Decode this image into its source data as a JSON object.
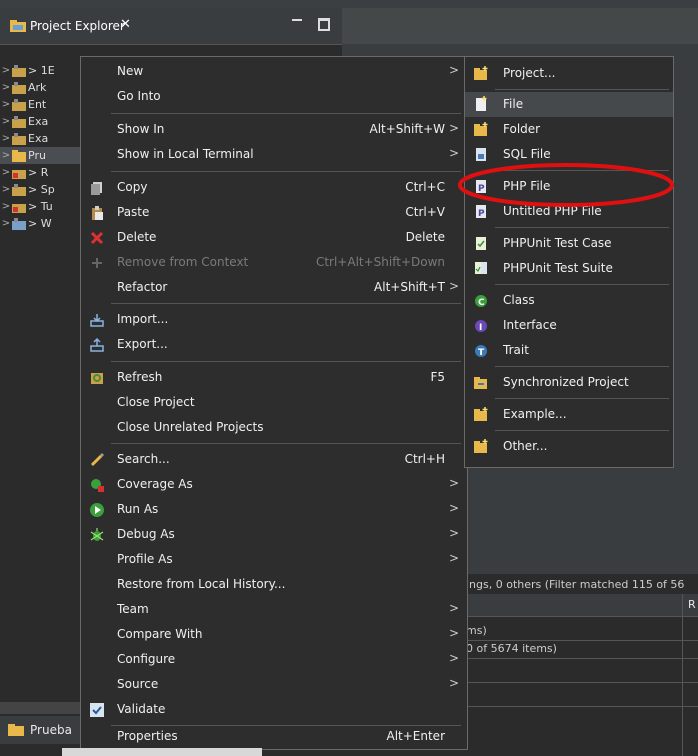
{
  "explorer": {
    "title": "Project Explorer",
    "tree": [
      {
        "label": "> 1E"
      },
      {
        "label": "Ark"
      },
      {
        "label": "Ent"
      },
      {
        "label": "Exa"
      },
      {
        "label": "Exa"
      },
      {
        "label": "Pru"
      },
      {
        "label": "> R"
      },
      {
        "label": "> Sp"
      },
      {
        "label": "> Tu"
      },
      {
        "label": "> W"
      }
    ],
    "bottom_tab": "Prueba"
  },
  "problems": {
    "summary": "ings, 0 others (Filter matched 115 of 56",
    "col_r": "R",
    "row1": "ms)",
    "row2": "0 of 5674 items)"
  },
  "menu": {
    "items": [
      {
        "label": "New",
        "shortcut": "",
        "arrow": ">"
      },
      {
        "label": "Go Into",
        "shortcut": "",
        "arrow": ""
      },
      {
        "label": "Show In",
        "shortcut": "Alt+Shift+W",
        "arrow": ">"
      },
      {
        "label": "Show in Local Terminal",
        "shortcut": "",
        "arrow": ">"
      },
      {
        "label": "Copy",
        "shortcut": "Ctrl+C",
        "arrow": ""
      },
      {
        "label": "Paste",
        "shortcut": "Ctrl+V",
        "arrow": ""
      },
      {
        "label": "Delete",
        "shortcut": "Delete",
        "arrow": ""
      },
      {
        "label": "Remove from Context",
        "shortcut": "Ctrl+Alt+Shift+Down",
        "arrow": ""
      },
      {
        "label": "Refactor",
        "shortcut": "Alt+Shift+T",
        "arrow": ">"
      },
      {
        "label": "Import...",
        "shortcut": "",
        "arrow": ""
      },
      {
        "label": "Export...",
        "shortcut": "",
        "arrow": ""
      },
      {
        "label": "Refresh",
        "shortcut": "F5",
        "arrow": ""
      },
      {
        "label": "Close Project",
        "shortcut": "",
        "arrow": ""
      },
      {
        "label": "Close Unrelated Projects",
        "shortcut": "",
        "arrow": ""
      },
      {
        "label": "Search...",
        "shortcut": "Ctrl+H",
        "arrow": ""
      },
      {
        "label": "Coverage As",
        "shortcut": "",
        "arrow": ">"
      },
      {
        "label": "Run As",
        "shortcut": "",
        "arrow": ">"
      },
      {
        "label": "Debug As",
        "shortcut": "",
        "arrow": ">"
      },
      {
        "label": "Profile As",
        "shortcut": "",
        "arrow": ">"
      },
      {
        "label": "Restore from Local History...",
        "shortcut": "",
        "arrow": ""
      },
      {
        "label": "Team",
        "shortcut": "",
        "arrow": ">"
      },
      {
        "label": "Compare With",
        "shortcut": "",
        "arrow": ">"
      },
      {
        "label": "Configure",
        "shortcut": "",
        "arrow": ">"
      },
      {
        "label": "Source",
        "shortcut": "",
        "arrow": ">"
      },
      {
        "label": "Validate",
        "shortcut": "",
        "arrow": ""
      },
      {
        "label": "Properties",
        "shortcut": "Alt+Enter",
        "arrow": ""
      }
    ]
  },
  "submenu": {
    "items": [
      {
        "label": "Project..."
      },
      {
        "label": "File"
      },
      {
        "label": "Folder"
      },
      {
        "label": "SQL File"
      },
      {
        "label": "PHP File"
      },
      {
        "label": "Untitled PHP File"
      },
      {
        "label": "PHPUnit Test Case"
      },
      {
        "label": "PHPUnit Test Suite"
      },
      {
        "label": "Class"
      },
      {
        "label": "Interface"
      },
      {
        "label": "Trait"
      },
      {
        "label": "Synchronized Project"
      },
      {
        "label": "Example..."
      },
      {
        "label": "Other..."
      }
    ]
  },
  "colors": {
    "highlight_circle": "#e01010",
    "menu_bg": "#2d2d2d",
    "folder_icon": "#e8b84a",
    "delete_icon": "#e03030"
  }
}
